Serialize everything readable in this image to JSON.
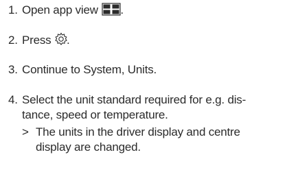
{
  "steps": [
    {
      "number": "1.",
      "text": "Open app view",
      "icon": "app-view-grid-icon",
      "suffix": "."
    },
    {
      "number": "2.",
      "text": "Press",
      "icon": "settings-gear-icon",
      "suffix": "."
    },
    {
      "number": "3.",
      "text": "Continue to System, Units."
    },
    {
      "number": "4.",
      "lines": [
        "Select the unit standard required for e.g. dis-",
        "tance, speed or temperature."
      ],
      "result": {
        "marker": ">",
        "lines": [
          "The units in the driver display and centre",
          "display are changed."
        ]
      }
    }
  ]
}
